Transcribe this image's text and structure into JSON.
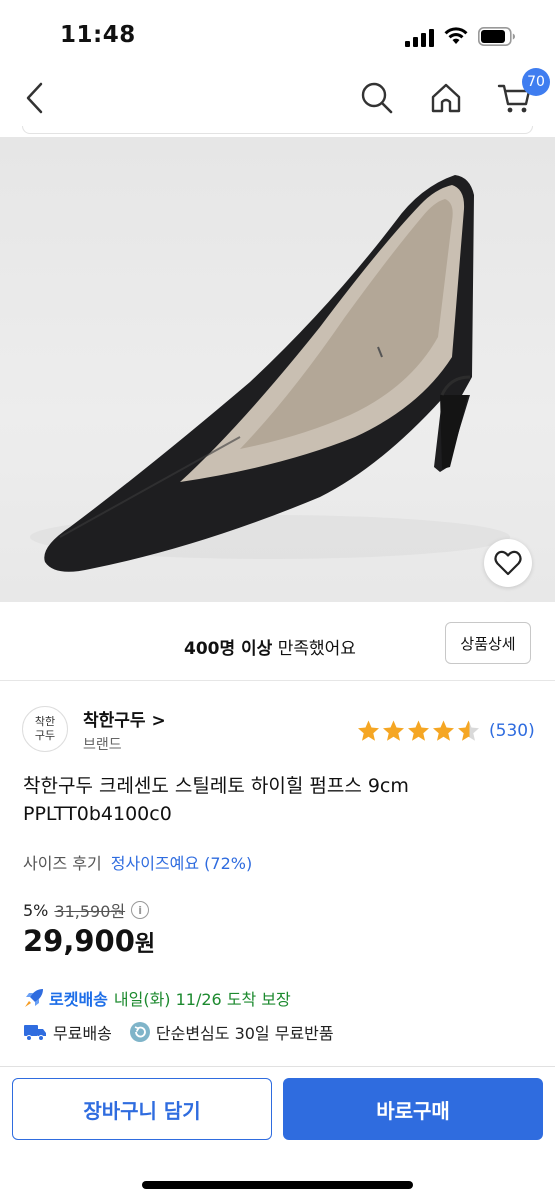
{
  "status_bar": {
    "time": "11:48"
  },
  "nav": {
    "icons": [
      "back-icon",
      "search-icon",
      "home-icon",
      "cart-icon"
    ],
    "cart_badge": "70",
    "accent_color": "#3f7df0"
  },
  "product_image": {
    "actions": [
      "heart-icon",
      "gift-icon",
      "share-icon"
    ]
  },
  "satisfaction": {
    "count": "400명 이상",
    "text": " 만족했어요",
    "detail_button": "상품상세"
  },
  "brand": {
    "logo_line1": "착한",
    "logo_line2": "구두",
    "name": "착한구두 >",
    "sub": "브랜드"
  },
  "rating": {
    "stars": 4.5,
    "count": "(530)",
    "star_color": "#f5a623"
  },
  "product": {
    "title_line1": "착한구두 크레센도 스틸레토 하이힐 펌프스 9cm",
    "title_line2": "PPLTT0b4100c0"
  },
  "size_review": {
    "label": "사이즈 후기",
    "value": "정사이즈예요 (72%)"
  },
  "price": {
    "discount": "5%",
    "original": "31,590원",
    "info_icon": "i",
    "sale": "29,900",
    "sale_unit": "원"
  },
  "delivery": {
    "rocket_icon": "rocket-icon",
    "rocket_label": "로켓배송",
    "rocket_text": "내일(화) 11/26 도착 보장",
    "free_ship_icon": "truck-icon",
    "free_ship": "무료배송",
    "return_icon": "return-icon",
    "return_text": "단순변심도 30일 무료반품"
  },
  "actions": {
    "cart": "장바구니 담기",
    "buy": "바로구매",
    "primary_color": "#2f6cdf"
  }
}
